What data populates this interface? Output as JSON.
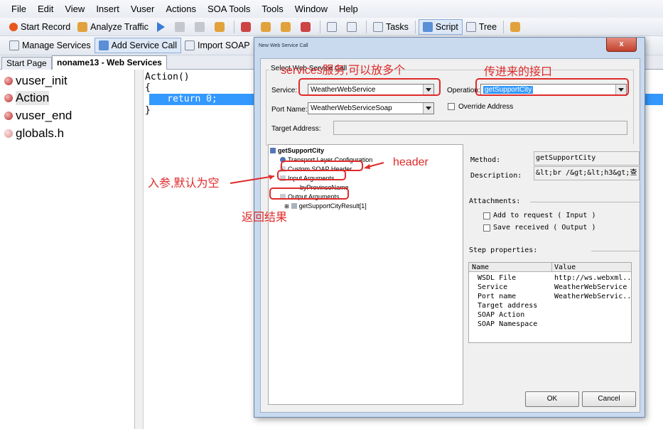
{
  "menu": [
    "File",
    "Edit",
    "View",
    "Insert",
    "Vuser",
    "Actions",
    "SOA Tools",
    "Tools",
    "Window",
    "Help"
  ],
  "toolbar1": {
    "start_record": "Start Record",
    "analyze_traffic": "Analyze Traffic",
    "tasks": "Tasks",
    "script": "Script",
    "tree": "Tree"
  },
  "toolbar2": {
    "manage_services": "Manage Services",
    "add_service_call": "Add Service Call",
    "import_soap": "Import SOAP"
  },
  "tabs": [
    "Start Page",
    "noname13 - Web Services"
  ],
  "left_tree": [
    "vuser_init",
    "Action",
    "vuser_end",
    "globals.h"
  ],
  "editor": {
    "lines": [
      "Action()",
      "{",
      "    return 0;",
      "}"
    ]
  },
  "dialog": {
    "title": "New Web Service Call",
    "close": "x",
    "group_title": "Select Web Service Call",
    "service_label": "Service:",
    "service_value": "WeatherWebService",
    "operation_label": "Operation:",
    "operation_value": "getSupportCity",
    "port_name_label": "Port Name:",
    "port_name_value": "WeatherWebServiceSoap",
    "override_address": "Override Address",
    "target_address_label": "Target Address:",
    "tree": {
      "root": "getSupportCity",
      "transport": "Transport Layer Configuration",
      "custom_header": "Custom SOAP Header",
      "input_args": "Input Arguments",
      "input_child": "byProvinceName",
      "output_args": "Output Arguments",
      "output_child": "getSupportCityResult[1]"
    },
    "details": {
      "method_label": "Method:",
      "method_value": "getSupportCity",
      "description_label": "Description:",
      "description_value": "&lt;br /&gt;&lt;h3&gt;查",
      "attachments_label": "Attachments:",
      "add_to_request": "Add to request ( Input )",
      "save_received": "Save received ( Output )",
      "step_properties_label": "Step properties:",
      "table_headers": [
        "Name",
        "Value"
      ],
      "properties": [
        {
          "name": "WSDL File",
          "value": "http://ws.webxml.."
        },
        {
          "name": "Service",
          "value": "WeatherWebService"
        },
        {
          "name": "Port name",
          "value": "WeatherWebServic.."
        },
        {
          "name": "Target address",
          "value": ""
        },
        {
          "name": "SOAP Action",
          "value": ""
        },
        {
          "name": "SOAP Namespace",
          "value": ""
        }
      ]
    },
    "ok": "OK",
    "cancel": "Cancel"
  },
  "annotations": {
    "services": "services服务,可以放多个",
    "operation": "传进来的接口",
    "header": "header",
    "input": "入参,默认为空",
    "output": "返回结果"
  },
  "colors": {
    "annotation_red": "#e02a2a",
    "selection_blue": "#3399ff"
  }
}
